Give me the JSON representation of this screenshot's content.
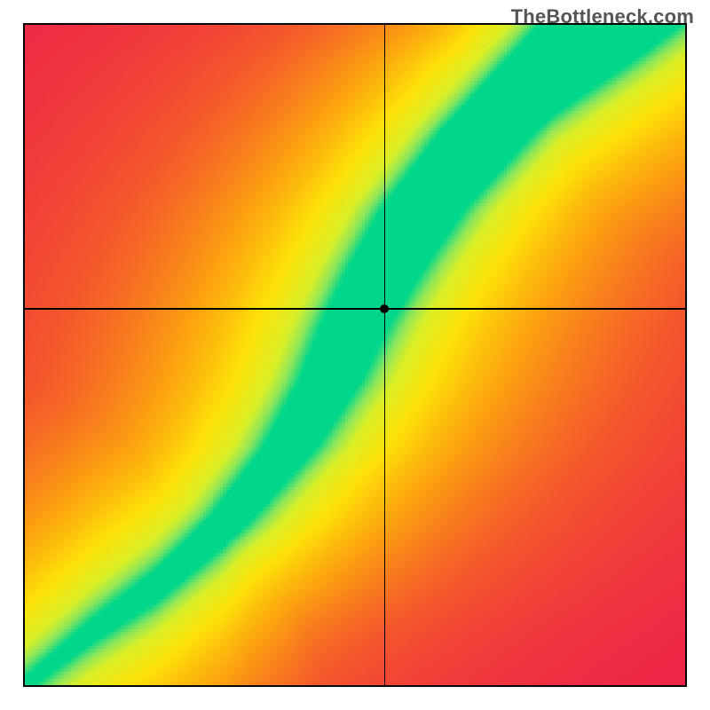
{
  "watermark": "TheBottleneck.com",
  "chart_data": {
    "type": "heatmap",
    "title": "",
    "xlabel": "",
    "ylabel": "",
    "x_range": [
      0,
      1
    ],
    "y_range": [
      0,
      1
    ],
    "marker": {
      "x": 0.545,
      "y": 0.57
    },
    "crosshair": {
      "x": 0.545,
      "y": 0.57
    },
    "ridge": {
      "description": "Green optimal band running diagonally; value 1 on ridge, falling to 0 away from it.",
      "points": [
        {
          "x": 0.0,
          "y": 0.0
        },
        {
          "x": 0.1,
          "y": 0.08
        },
        {
          "x": 0.2,
          "y": 0.15
        },
        {
          "x": 0.3,
          "y": 0.24
        },
        {
          "x": 0.4,
          "y": 0.36
        },
        {
          "x": 0.46,
          "y": 0.46
        },
        {
          "x": 0.5,
          "y": 0.55
        },
        {
          "x": 0.55,
          "y": 0.64
        },
        {
          "x": 0.6,
          "y": 0.72
        },
        {
          "x": 0.7,
          "y": 0.84
        },
        {
          "x": 0.8,
          "y": 0.94
        },
        {
          "x": 0.88,
          "y": 1.0
        }
      ],
      "half_width_start": 0.01,
      "half_width_end": 0.085
    },
    "corner_values": {
      "bottom_left": 1.0,
      "top_left": 0.0,
      "bottom_right": 0.0,
      "top_right": 0.55
    },
    "colormap": {
      "stops": [
        {
          "t": 0.0,
          "color": "#ec1a4d"
        },
        {
          "t": 0.28,
          "color": "#f55a2a"
        },
        {
          "t": 0.52,
          "color": "#fca40e"
        },
        {
          "t": 0.72,
          "color": "#fde208"
        },
        {
          "t": 0.86,
          "color": "#d9ef27"
        },
        {
          "t": 0.93,
          "color": "#8ee65a"
        },
        {
          "t": 1.0,
          "color": "#00d78b"
        }
      ]
    }
  }
}
